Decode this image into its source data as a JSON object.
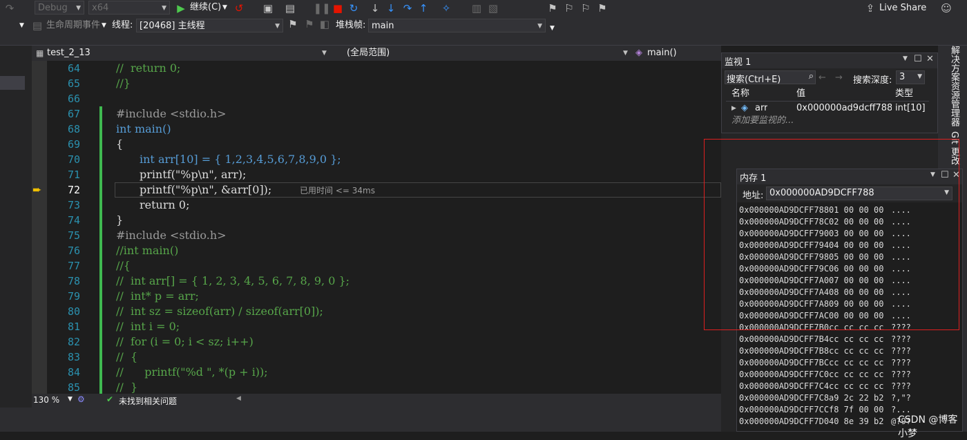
{
  "toolbar": {
    "config": "Debug",
    "platform": "x64",
    "continue_label": "继续(C)",
    "live_share": "Live Share"
  },
  "toolbar2": {
    "lifecycle": "生命周期事件",
    "thread_label": "线程:",
    "thread_value": "[20468] 主线程",
    "stack_label": "堆栈帧:",
    "stack_value": "main"
  },
  "document": {
    "file": "test_2_13",
    "scope": "(全局范围)",
    "func": "main()"
  },
  "editor": {
    "current_line": 72,
    "elapsed_hint": "已用时间 <= 34ms",
    "lines": [
      {
        "n": "64",
        "text": "//  return 0;"
      },
      {
        "n": "65",
        "text": "//}"
      },
      {
        "n": "66",
        "text": ""
      },
      {
        "n": "67",
        "text": "#include <stdio.h>"
      },
      {
        "n": "68",
        "text": "int main()"
      },
      {
        "n": "69",
        "text": "{"
      },
      {
        "n": "70",
        "text": "int arr[10] = { 1,2,3,4,5,6,7,8,9,0 };"
      },
      {
        "n": "71",
        "text": "printf(\"%p\\n\", arr);"
      },
      {
        "n": "72",
        "text": "printf(\"%p\\n\", &arr[0]);"
      },
      {
        "n": "73",
        "text": "return 0;"
      },
      {
        "n": "74",
        "text": "}"
      },
      {
        "n": "75",
        "text": "#include <stdio.h>"
      },
      {
        "n": "76",
        "text": "//int main()"
      },
      {
        "n": "77",
        "text": "//{"
      },
      {
        "n": "78",
        "text": "//  int arr[] = { 1, 2, 3, 4, 5, 6, 7, 8, 9, 0 };"
      },
      {
        "n": "79",
        "text": "//  int* p = arr;"
      },
      {
        "n": "80",
        "text": "//  int sz = sizeof(arr) / sizeof(arr[0]);"
      },
      {
        "n": "81",
        "text": "//  int i = 0;"
      },
      {
        "n": "82",
        "text": "//  for (i = 0; i < sz; i++)"
      },
      {
        "n": "83",
        "text": "//  {"
      },
      {
        "n": "84",
        "text": "//      printf(\"%d \", *(p + i));"
      },
      {
        "n": "85",
        "text": "//  }"
      }
    ]
  },
  "status": {
    "zoom": "130 %",
    "issues": "未找到相关问题"
  },
  "watch": {
    "title": "监视 1",
    "search_placeholder": "搜索(Ctrl+E)",
    "depth_label": "搜索深度:",
    "depth_value": "3",
    "col_name": "名称",
    "col_value": "值",
    "col_type": "类型",
    "item_name": "arr",
    "item_value": "0x000000ad9dcff788 {...",
    "item_type": "int[10]",
    "add_placeholder": "添加要监视的...",
    "rail_tab1": "解决方案资源管理器",
    "rail_tab2": "Git 更改"
  },
  "memory": {
    "title": "内存 1",
    "addr_label": "地址:",
    "addr_value": "0x000000AD9DCFF788",
    "rows": [
      {
        "addr": "0x000000AD9DCFF788",
        "hex": "01 00 00 00",
        "ascii": "...."
      },
      {
        "addr": "0x000000AD9DCFF78C",
        "hex": "02 00 00 00",
        "ascii": "...."
      },
      {
        "addr": "0x000000AD9DCFF790",
        "hex": "03 00 00 00",
        "ascii": "...."
      },
      {
        "addr": "0x000000AD9DCFF794",
        "hex": "04 00 00 00",
        "ascii": "...."
      },
      {
        "addr": "0x000000AD9DCFF798",
        "hex": "05 00 00 00",
        "ascii": "...."
      },
      {
        "addr": "0x000000AD9DCFF79C",
        "hex": "06 00 00 00",
        "ascii": "...."
      },
      {
        "addr": "0x000000AD9DCFF7A0",
        "hex": "07 00 00 00",
        "ascii": "...."
      },
      {
        "addr": "0x000000AD9DCFF7A4",
        "hex": "08 00 00 00",
        "ascii": "...."
      },
      {
        "addr": "0x000000AD9DCFF7A8",
        "hex": "09 00 00 00",
        "ascii": "...."
      },
      {
        "addr": "0x000000AD9DCFF7AC",
        "hex": "00 00 00 00",
        "ascii": "...."
      },
      {
        "addr": "0x000000AD9DCFF7B0",
        "hex": "cc cc cc cc",
        "ascii": "????"
      },
      {
        "addr": "0x000000AD9DCFF7B4",
        "hex": "cc cc cc cc",
        "ascii": "????"
      },
      {
        "addr": "0x000000AD9DCFF7B8",
        "hex": "cc cc cc cc",
        "ascii": "????"
      },
      {
        "addr": "0x000000AD9DCFF7BC",
        "hex": "cc cc cc cc",
        "ascii": "????"
      },
      {
        "addr": "0x000000AD9DCFF7C0",
        "hex": "cc cc cc cc",
        "ascii": "????"
      },
      {
        "addr": "0x000000AD9DCFF7C4",
        "hex": "cc cc cc cc",
        "ascii": "????"
      },
      {
        "addr": "0x000000AD9DCFF7C8",
        "hex": "a9 2c 22 b2",
        "ascii": "?,\"?"
      },
      {
        "addr": "0x000000AD9DCFF7CC",
        "hex": "f8 7f 00 00",
        "ascii": "?..."
      },
      {
        "addr": "0x000000AD9DCFF7D0",
        "hex": "40 8e 39 b2",
        "ascii": "@?9?"
      }
    ]
  },
  "watermark": "CSDN @博客小梦"
}
